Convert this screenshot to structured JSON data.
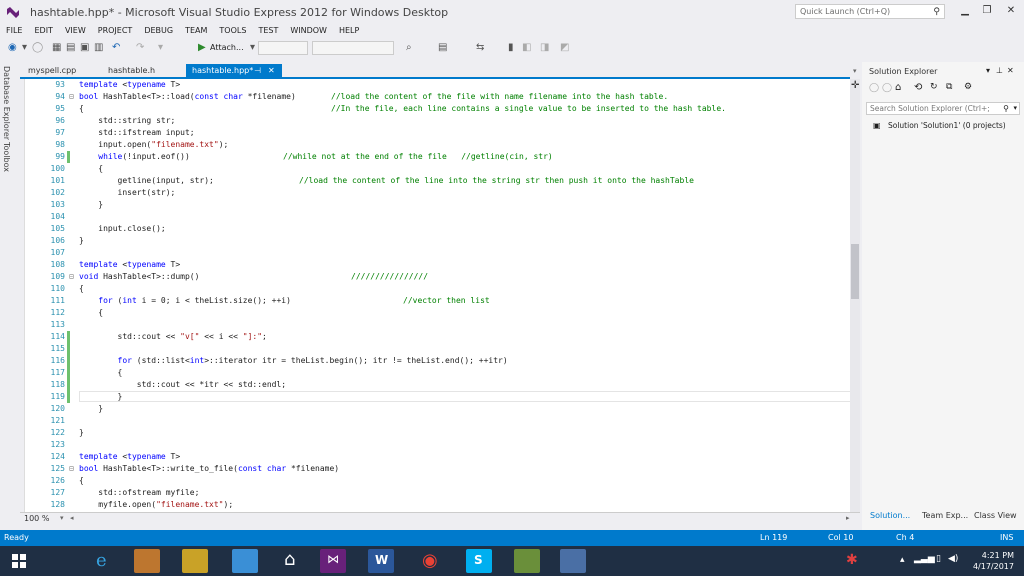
{
  "window": {
    "title": "hashtable.hpp* - Microsoft Visual Studio Express 2012 for Windows Desktop",
    "quick_launch_placeholder": "Quick Launch (Ctrl+Q)"
  },
  "menu": [
    "FILE",
    "EDIT",
    "VIEW",
    "PROJECT",
    "DEBUG",
    "TEAM",
    "TOOLS",
    "TEST",
    "WINDOW",
    "HELP"
  ],
  "toolbar": {
    "attach_label": "Attach..."
  },
  "side_strip": [
    "Database Explorer",
    "Toolbox"
  ],
  "tabs": [
    {
      "label": "myspell.cpp",
      "active": false
    },
    {
      "label": "hashtable.h",
      "active": false
    },
    {
      "label": "hashtable.hpp*",
      "active": true
    }
  ],
  "active_tab_pin": "⊣",
  "active_tab_close": "✕",
  "code_lines": [
    {
      "n": "93",
      "code": "template <typename T>"
    },
    {
      "n": "94",
      "code": "bool HashTable<T>::load(const char *filename)",
      "comment": "//load the content of the file with name filename into the hash table."
    },
    {
      "n": "95",
      "code": "{",
      "comment": "//In the file, each line contains a single value to be inserted to the hash table."
    },
    {
      "n": "96",
      "code": "    std::string str;"
    },
    {
      "n": "97",
      "code": "    std::ifstream input;"
    },
    {
      "n": "98",
      "code": "    input.open(\"filename.txt\");"
    },
    {
      "n": "99",
      "code": "    while(!input.eof())",
      "comment": "//while not at the end of the file   //getline(cin, str)"
    },
    {
      "n": "100",
      "code": "    {"
    },
    {
      "n": "101",
      "code": "        getline(input, str);",
      "comment": "//load the content of the line into the string str then push it onto the hashTable"
    },
    {
      "n": "102",
      "code": "        insert(str);"
    },
    {
      "n": "103",
      "code": "    }"
    },
    {
      "n": "104",
      "code": ""
    },
    {
      "n": "105",
      "code": "    input.close();"
    },
    {
      "n": "106",
      "code": "}"
    },
    {
      "n": "107",
      "code": ""
    },
    {
      "n": "108",
      "code": "template <typename T>"
    },
    {
      "n": "109",
      "code": "void HashTable<T>::dump()",
      "comment": "////////////////"
    },
    {
      "n": "110",
      "code": "{"
    },
    {
      "n": "111",
      "code": "    for (int i = 0; i < theList.size(); ++i)",
      "comment": "//vector then list"
    },
    {
      "n": "112",
      "code": "    {"
    },
    {
      "n": "113",
      "code": ""
    },
    {
      "n": "114",
      "code": "        std::cout << \"v[\" << i << \"]:\";"
    },
    {
      "n": "115",
      "code": ""
    },
    {
      "n": "116",
      "code": "        for (std::list<int>::iterator itr = theList.begin(); itr != theList.end(); ++itr)"
    },
    {
      "n": "117",
      "code": "        {"
    },
    {
      "n": "118",
      "code": "            std::cout << *itr << std::endl;"
    },
    {
      "n": "119",
      "code": "        }"
    },
    {
      "n": "120",
      "code": "    }"
    },
    {
      "n": "121",
      "code": ""
    },
    {
      "n": "122",
      "code": "}"
    },
    {
      "n": "123",
      "code": ""
    },
    {
      "n": "124",
      "code": "template <typename T>"
    },
    {
      "n": "125",
      "code": "bool HashTable<T>::write_to_file(const char *filename)"
    },
    {
      "n": "126",
      "code": "{"
    },
    {
      "n": "127",
      "code": "    std::ofstream myfile;"
    },
    {
      "n": "128",
      "code": "    myfile.open(\"filename.txt\");"
    }
  ],
  "editor": {
    "zoom": "100 %"
  },
  "solution_explorer": {
    "title": "Solution Explorer",
    "search_placeholder": "Search Solution Explorer (Ctrl+;",
    "solution_label": "Solution 'Solution1' (0 projects)",
    "bottom_tabs": [
      "Solution...",
      "Team Exp...",
      "Class View"
    ]
  },
  "status": {
    "ready": "Ready",
    "line": "Ln 119",
    "col": "Col 10",
    "ch": "Ch 4",
    "mode": "INS"
  },
  "taskbar": {
    "time": "4:21 PM",
    "date": "4/17/2017"
  },
  "colors": {
    "accent": "#007acc",
    "keyword": "#0000ff",
    "comment": "#008000",
    "string": "#a31515",
    "line_number": "#2b91af"
  }
}
